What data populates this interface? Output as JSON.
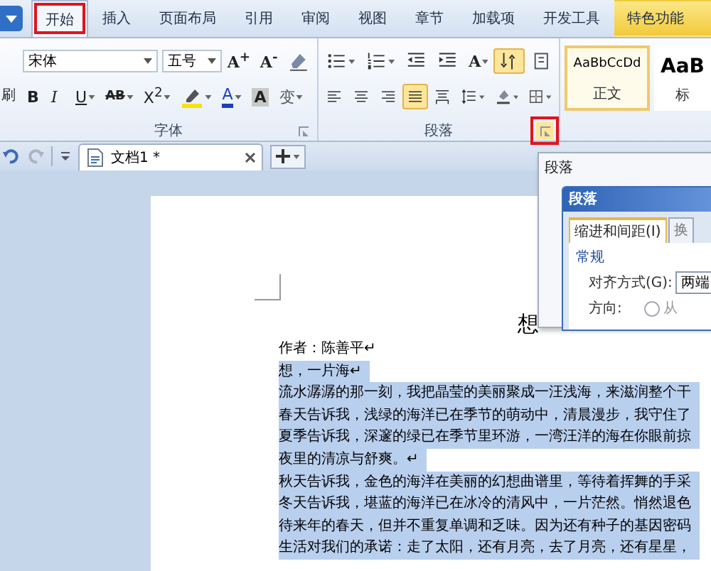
{
  "tabs": [
    {
      "label": "开始",
      "selected": true,
      "annotated": true,
      "kind": "normal"
    },
    {
      "label": "插入",
      "selected": false,
      "annotated": false,
      "kind": "normal"
    },
    {
      "label": "页面布局",
      "selected": false,
      "annotated": false,
      "kind": "normal"
    },
    {
      "label": "引用",
      "selected": false,
      "annotated": false,
      "kind": "normal"
    },
    {
      "label": "审阅",
      "selected": false,
      "annotated": false,
      "kind": "normal"
    },
    {
      "label": "视图",
      "selected": false,
      "annotated": false,
      "kind": "normal"
    },
    {
      "label": "章节",
      "selected": false,
      "annotated": false,
      "kind": "normal"
    },
    {
      "label": "加载项",
      "selected": false,
      "annotated": false,
      "kind": "normal"
    },
    {
      "label": "开发工具",
      "selected": false,
      "annotated": false,
      "kind": "normal"
    },
    {
      "label": "特色功能",
      "selected": false,
      "annotated": false,
      "kind": "special"
    }
  ],
  "clipboard": {
    "label": "刷"
  },
  "font_group": {
    "label": "字体",
    "font": "宋体",
    "size": "五号",
    "row1": [
      {
        "kind": "grow",
        "label": "A$^{+}$",
        "dropdown": false
      },
      {
        "kind": "shrink",
        "label": "A$^{-}$",
        "dropdown": false
      },
      {
        "kind": "clear",
        "dropdown": false
      }
    ],
    "row2": [
      {
        "kind": "bold",
        "label": "B",
        "dropdown": false
      },
      {
        "kind": "italic",
        "label": "I",
        "dropdown": false
      },
      {
        "kind": "underline",
        "label": "U",
        "dropdown": true
      },
      {
        "kind": "strike",
        "label": "AB",
        "dropdown": true
      },
      {
        "kind": "super",
        "label": "X$^{2}$",
        "dropdown": true
      },
      {
        "kind": "highlight",
        "dropdown": true
      },
      {
        "kind": "color",
        "label": "A",
        "dropdown": true
      },
      {
        "kind": "shade",
        "label": "A",
        "dropdown": false
      },
      {
        "kind": "phonetic",
        "label": "变",
        "dropdown": true
      }
    ]
  },
  "paragraph_group": {
    "label": "段落",
    "launcher_annotated": true,
    "row1": [
      {
        "kind": "bullets",
        "dropdown": true,
        "selected": false
      },
      {
        "kind": "numbering",
        "dropdown": true,
        "selected": false
      },
      {
        "kind": "outdent",
        "dropdown": false,
        "selected": false
      },
      {
        "kind": "indent",
        "dropdown": false,
        "selected": false
      },
      {
        "kind": "dir",
        "label": "A",
        "dropdown": true,
        "selected": false
      },
      {
        "kind": "sort",
        "dropdown": false,
        "selected": true
      },
      {
        "kind": "marks",
        "dropdown": false,
        "selected": false
      }
    ],
    "row2": [
      {
        "kind": "align-left",
        "dropdown": false,
        "selected": false
      },
      {
        "kind": "align-center",
        "dropdown": false,
        "selected": false
      },
      {
        "kind": "align-right",
        "dropdown": false,
        "selected": false
      },
      {
        "kind": "justify",
        "dropdown": false,
        "selected": true
      },
      {
        "kind": "distribute",
        "dropdown": false,
        "selected": false
      },
      {
        "kind": "line-spacing",
        "dropdown": true,
        "selected": false
      },
      {
        "kind": "shading",
        "dropdown": true,
        "selected": false
      },
      {
        "kind": "border",
        "dropdown": true,
        "selected": false
      }
    ]
  },
  "styles": [
    {
      "sample": "AaBbCcDd",
      "label": "正文",
      "selected": true,
      "kind": "body"
    },
    {
      "sample": "AaB",
      "label": "标",
      "selected": false,
      "kind": "heading"
    }
  ],
  "document_tab": {
    "title": "文档1 *"
  },
  "document": {
    "title": "想",
    "lines": [
      {
        "text": "作者：陈善平↵",
        "selected": false
      },
      {
        "text": "想，一片海↵",
        "selected": true
      },
      {
        "text": "流水潺潺的那一刻，我把晶莹的美丽聚成一汪浅海，来滋润整个干",
        "selected": true
      },
      {
        "text": "春天告诉我，浅绿的海洋已在季节的萌动中，清晨漫步，我守住了",
        "selected": true
      },
      {
        "text": "夏季告诉我，深邃的绿已在季节里环游，一湾汪洋的海在你眼前掠",
        "selected": true
      },
      {
        "text": "夜里的清凉与舒爽。↵",
        "selected": true
      },
      {
        "text": "秋天告诉我，金色的海洋在美丽的幻想曲谱里，等待着挥舞的手采",
        "selected": true
      },
      {
        "text": "冬天告诉我，堪蓝的海洋已在冰冷的清风中，一片茫然。悄然退色",
        "selected": true
      },
      {
        "text": "待来年的春天，但并不重复单调和乏味。因为还有种子的基因密码",
        "selected": true
      },
      {
        "text": "生活对我们的承诺：走了太阳，还有月亮，去了月亮，还有星星，",
        "selected": true
      }
    ]
  },
  "tooltip": {
    "title": "段落",
    "dialog": {
      "title": "段落",
      "tabs": [
        {
          "label": "缩进和间距(I)",
          "selected": true
        },
        {
          "label": "换",
          "selected": false
        }
      ],
      "section": "常规",
      "alignment": {
        "label": "对齐方式(G):",
        "value": "两端"
      },
      "direction": {
        "label": "方向:",
        "option": "从",
        "checked": false
      }
    }
  }
}
